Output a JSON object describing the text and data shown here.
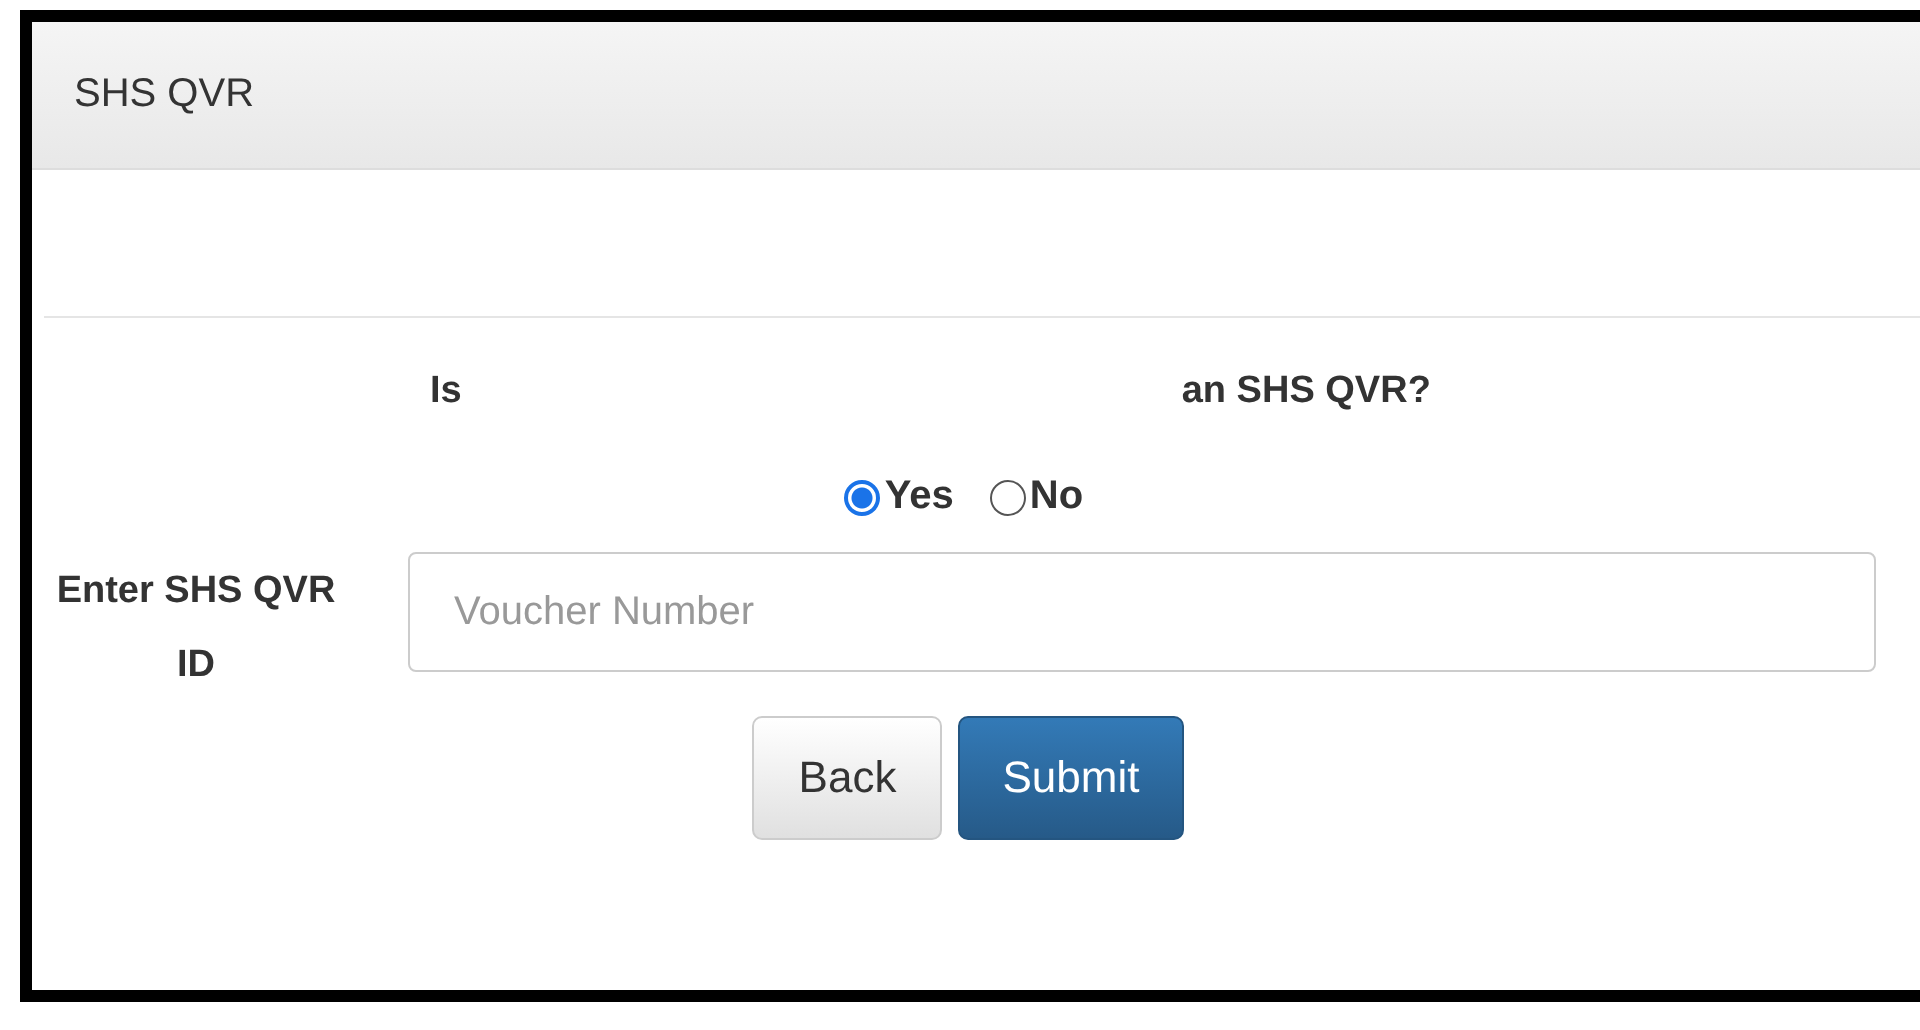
{
  "window": {
    "title": "SHS QVR"
  },
  "question": {
    "start": "Is",
    "end": "an SHS QVR?"
  },
  "options": [
    {
      "label": "Yes",
      "selected": true
    },
    {
      "label": "No",
      "selected": false
    }
  ],
  "voucher": {
    "label": "Enter SHS QVR ID",
    "placeholder": "Voucher Number"
  },
  "buttons": [
    {
      "label": "Back",
      "kind": "default"
    },
    {
      "label": "Submit",
      "kind": "primary"
    }
  ]
}
